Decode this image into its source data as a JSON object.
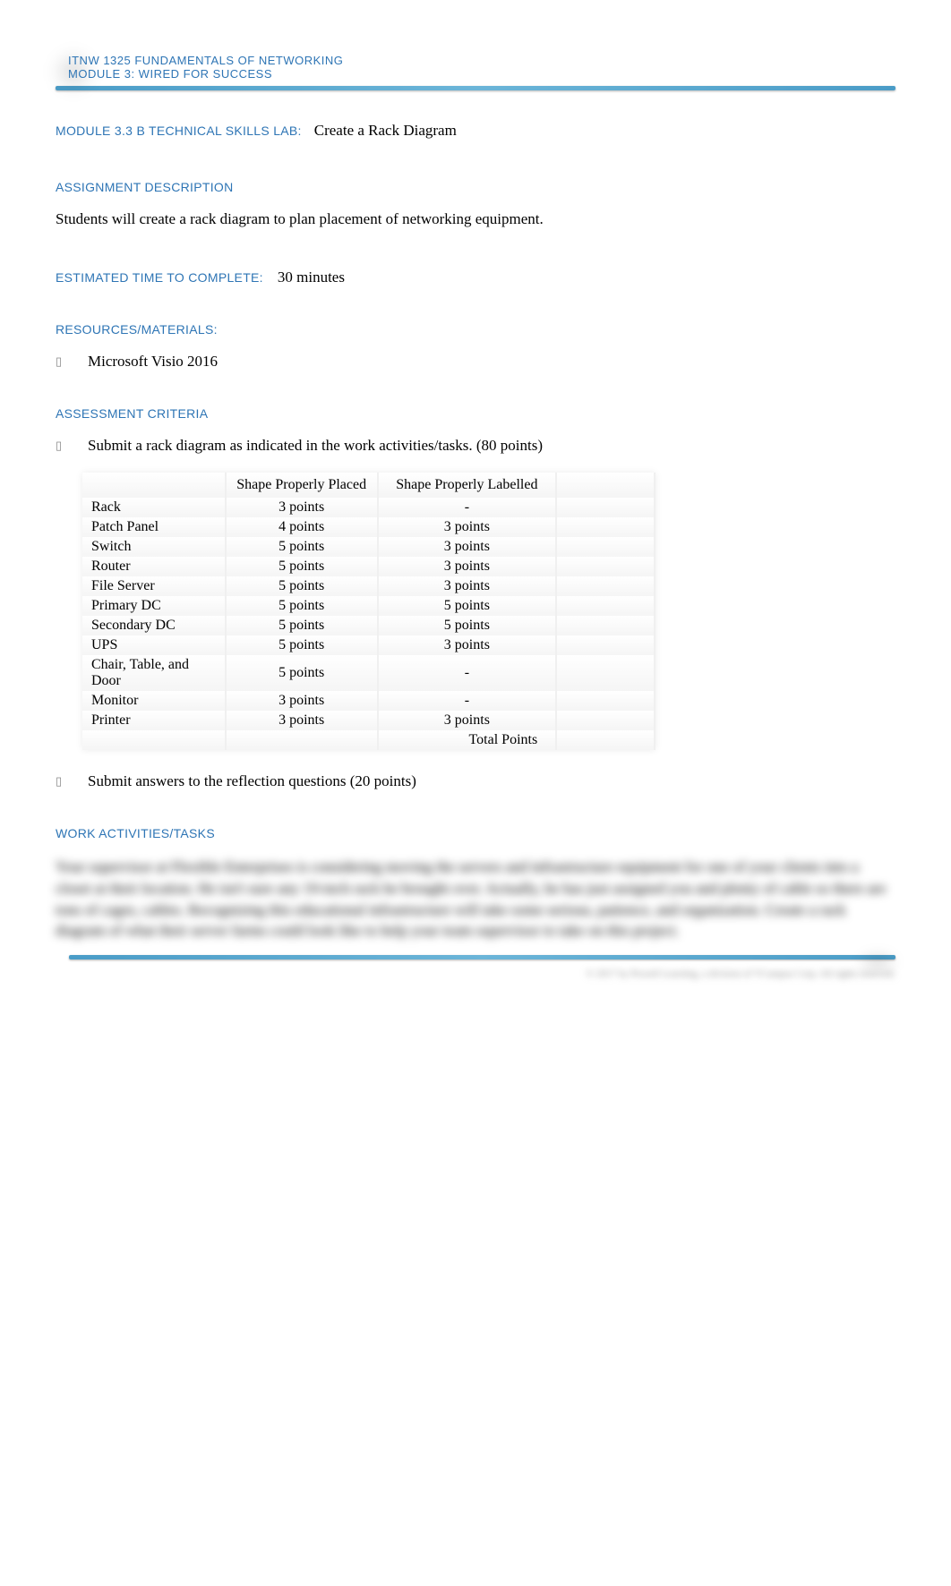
{
  "header": {
    "line1": "ITNW 1325 FUNDAMENTALS OF NETWORKING",
    "line2": "MODULE 3: WIRED FOR SUCCESS"
  },
  "lab": {
    "label": "MODULE 3.3 B TECHNICAL SKILLS LAB:",
    "title": "Create a Rack Diagram"
  },
  "assignment": {
    "heading": "ASSIGNMENT DESCRIPTION",
    "text": "Students will create a rack diagram to plan placement of networking equipment."
  },
  "time": {
    "label": "ESTIMATED TIME TO COMPLETE:",
    "value": "30 minutes"
  },
  "resources": {
    "heading": "RESOURCES/MATERIALS:",
    "items": [
      "Microsoft Visio 2016"
    ]
  },
  "assessment": {
    "heading": "ASSESSMENT CRITERIA",
    "item1": "Submit a rack diagram as indicated in the work activities/tasks. (80 points)",
    "item2": "Submit answers to the reflection questions (20 points)",
    "table": {
      "col_placed": "Shape Properly Placed",
      "col_labelled": "Shape Properly Labelled",
      "rows": [
        {
          "item": "Rack",
          "placed": "3 points",
          "labelled": "-"
        },
        {
          "item": "Patch Panel",
          "placed": "4 points",
          "labelled": "3 points"
        },
        {
          "item": "Switch",
          "placed": "5 points",
          "labelled": "3 points"
        },
        {
          "item": "Router",
          "placed": "5 points",
          "labelled": "3 points"
        },
        {
          "item": "File Server",
          "placed": "5 points",
          "labelled": "3 points"
        },
        {
          "item": "Primary DC",
          "placed": "5 points",
          "labelled": "5 points"
        },
        {
          "item": "Secondary DC",
          "placed": "5 points",
          "labelled": "5 points"
        },
        {
          "item": "UPS",
          "placed": "5 points",
          "labelled": "3 points"
        },
        {
          "item": "Chair, Table, and Door",
          "placed": "5 points",
          "labelled": "-"
        },
        {
          "item": "Monitor",
          "placed": "3 points",
          "labelled": "-"
        },
        {
          "item": "Printer",
          "placed": "3 points",
          "labelled": "3 points"
        }
      ],
      "total_label": "Total Points"
    }
  },
  "work_activities": {
    "heading": "WORK ACTIVITIES/TASKS",
    "blurred_text": "Your supervisor at Flexible Enterprises is considering moving the servers and infrastructure equipment for one of your clients into a closet at their location. He isn't sure any 19-inch rack he brought over. Actually, he has just assigned you and plenty of cable so there are tons of cages, cables. Recognizing this educational infrastructure will take some serious, patience, and organization. Create a rack diagram of what their server farms could look like to help your team supervisor to take on this project."
  },
  "footer": {
    "info": "© 2017 by Prosoft Learning, a division of VCampus Corp. All rights reserved."
  }
}
